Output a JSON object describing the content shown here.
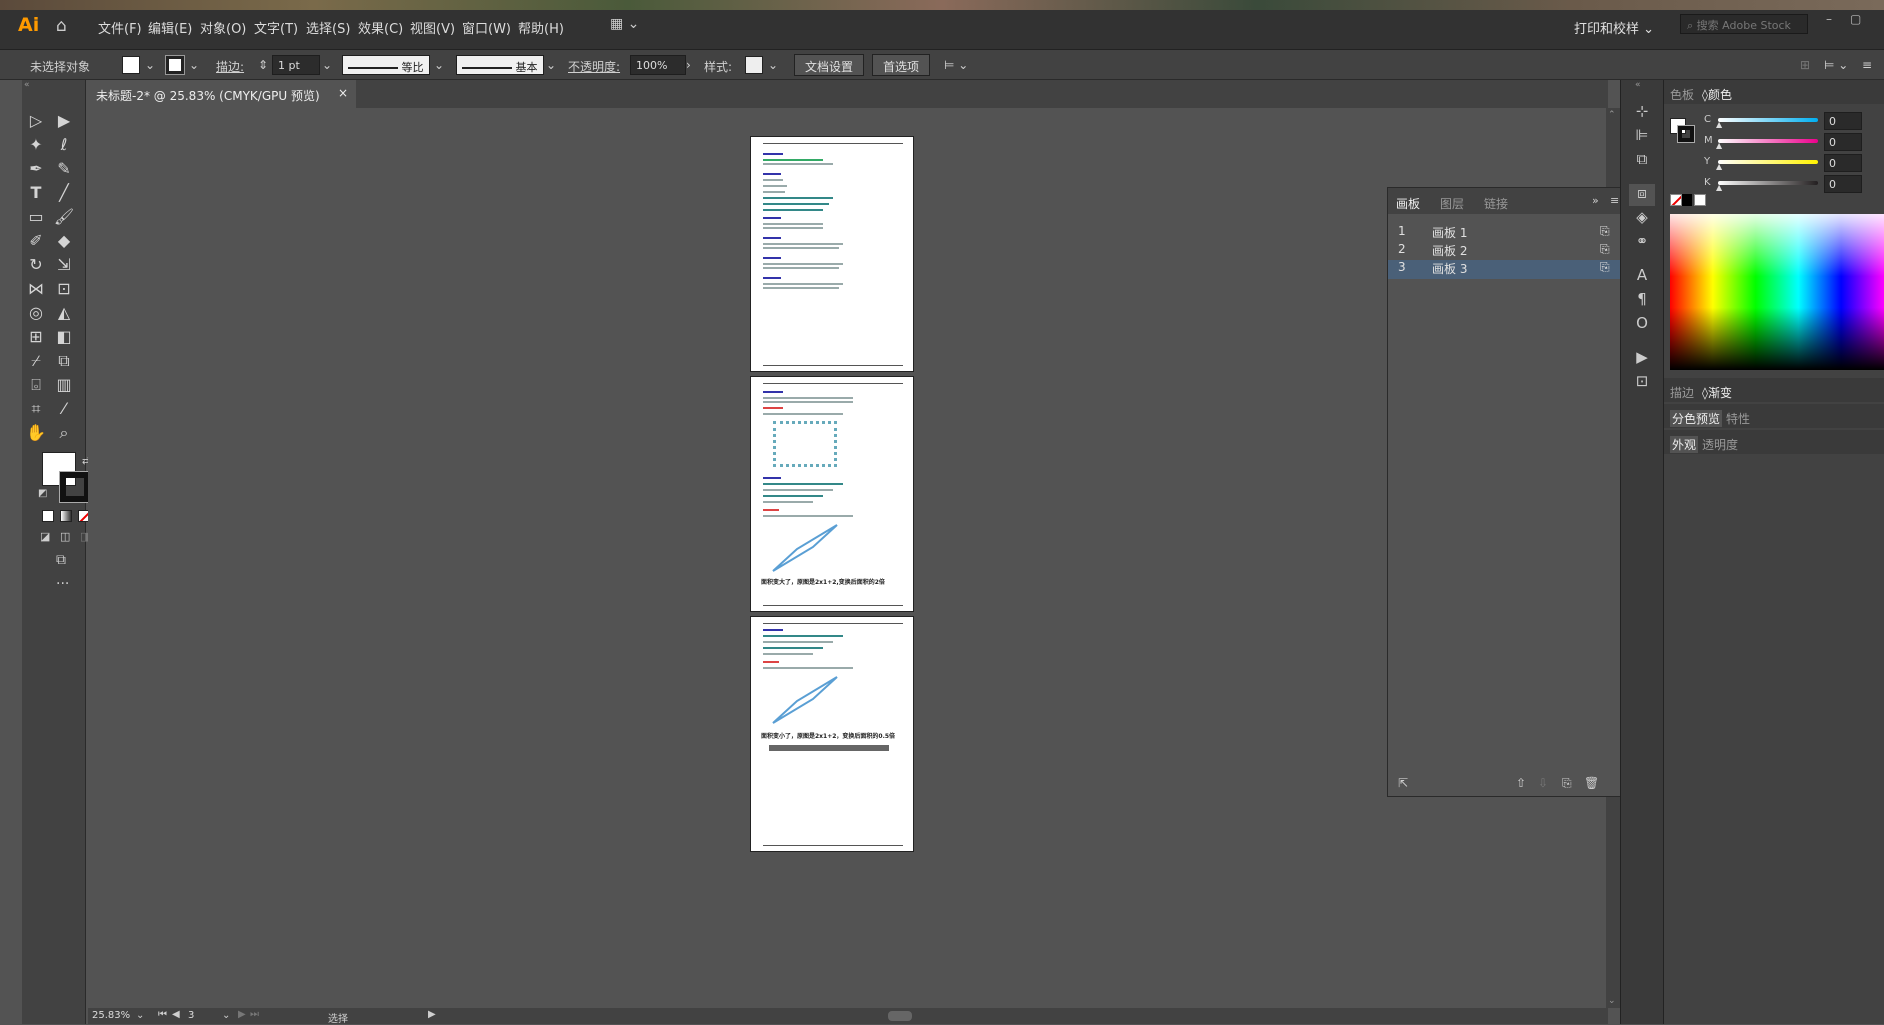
{
  "app": {
    "logo": "Ai"
  },
  "menu": [
    "文件(F)",
    "编辑(E)",
    "对象(O)",
    "文字(T)",
    "选择(S)",
    "效果(C)",
    "视图(V)",
    "窗口(W)",
    "帮助(H)"
  ],
  "workspace": {
    "label": "打印和校样",
    "search_placeholder": "搜索 Adobe Stock"
  },
  "control": {
    "no_selection": "未选择对象",
    "stroke_label": "描边:",
    "stroke_weight": "1 pt",
    "profile": "等比",
    "brush": "基本",
    "opacity_label": "不透明度:",
    "opacity": "100%",
    "style_label": "样式:",
    "doc_setup": "文档设置",
    "preferences": "首选项"
  },
  "document": {
    "tab_title": "未标题-2* @ 25.83% (CMYK/GPU 预览)",
    "close": "×"
  },
  "artboards_panel": {
    "tabs": [
      "画板",
      "图层",
      "链接"
    ],
    "rows": [
      {
        "num": "1",
        "name": "画板 1"
      },
      {
        "num": "2",
        "name": "画板 2"
      },
      {
        "num": "3",
        "name": "画板 3"
      }
    ]
  },
  "right_panel": {
    "color_tabs": [
      "色板",
      "颜色"
    ],
    "channels": [
      {
        "label": "C",
        "value": "0",
        "color": "#00aeef"
      },
      {
        "label": "M",
        "value": "0",
        "color": "#ec008c"
      },
      {
        "label": "Y",
        "value": "0",
        "color": "#fff200"
      },
      {
        "label": "K",
        "value": "0",
        "color": "#231f20"
      }
    ],
    "stroke_tabs": [
      "描边",
      "渐变"
    ],
    "sep_tabs": [
      "分色预览",
      "特性"
    ],
    "appear_tabs": [
      "外观",
      "透明度"
    ]
  },
  "page3": {
    "text1": "面积变小了，原图是2x1+2，变换后面积的0.5倍",
    "text2": "面积变大了，原图是2x1+2,变换后面积的2倍"
  },
  "status": {
    "zoom": "25.83%",
    "artboard": "3",
    "tool": "选择"
  }
}
